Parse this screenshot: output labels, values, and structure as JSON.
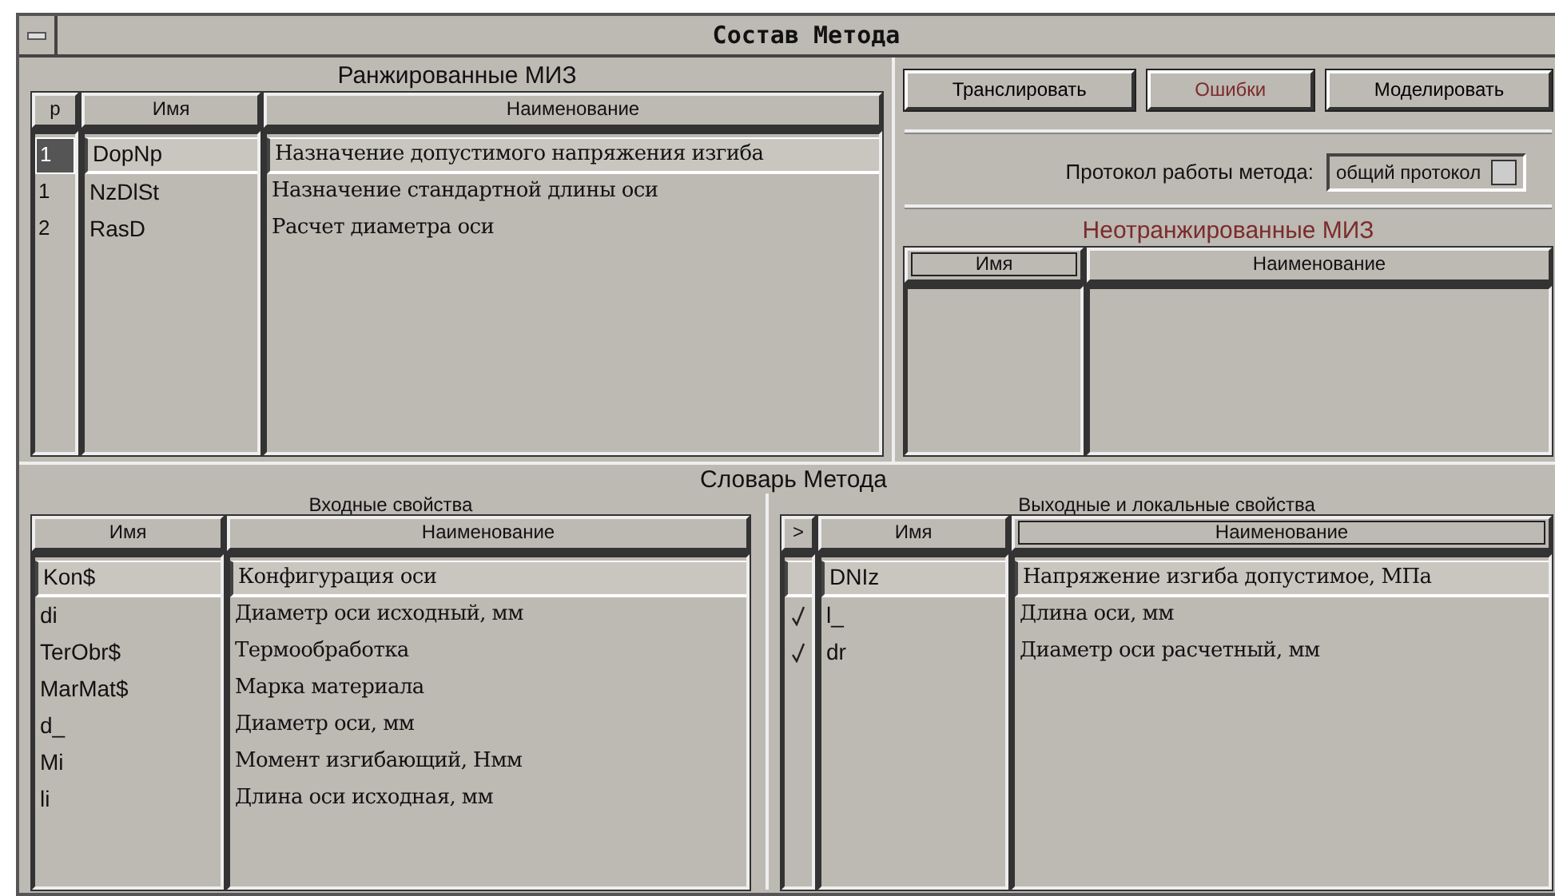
{
  "window": {
    "title": "Состав Метода"
  },
  "ranked": {
    "title": "Ранжированные МИЗ",
    "columns": [
      {
        "label": "р",
        "kind": "rank",
        "focused": false
      },
      {
        "label": "Имя",
        "kind": "name",
        "focused": false
      },
      {
        "label": "Наименование",
        "kind": "description",
        "focused": false
      }
    ],
    "rows": [
      {
        "cells": [
          "1",
          "DopNp",
          "Назначение допустимого напряжения изгиба"
        ],
        "selected": true
      },
      {
        "cells": [
          "1",
          "NzDlSt",
          "Назначение стандартной длины оси"
        ],
        "selected": false
      },
      {
        "cells": [
          "2",
          "RasD",
          "Расчет диаметра оси"
        ],
        "selected": false
      }
    ]
  },
  "actions": [
    {
      "label": "Транслировать",
      "color": "#000000"
    },
    {
      "label": "Ошибки",
      "color": "#7b2b2b"
    },
    {
      "label": "Моделировать",
      "color": "#000000"
    }
  ],
  "protocol": {
    "label": "Протокол работы метода:",
    "value": "общий протокол"
  },
  "unranked": {
    "title": "Неотранжированные МИЗ",
    "columns": [
      {
        "label": "Имя",
        "focused": true
      },
      {
        "label": "Наименование",
        "focused": false
      }
    ]
  },
  "dictionary": {
    "title": "Словарь Метода",
    "inputs": {
      "title": "Входные свойства",
      "columns": [
        {
          "label": "Имя",
          "kind": "name",
          "focused": false
        },
        {
          "label": "Наименование",
          "kind": "description",
          "focused": false
        }
      ],
      "rows": [
        {
          "cells": [
            "Kon$",
            "Конфигурация оси"
          ],
          "selected": true
        },
        {
          "cells": [
            "di",
            "Диаметр оси исходный, мм"
          ],
          "selected": false
        },
        {
          "cells": [
            "TerObr$",
            "Термообработка"
          ],
          "selected": false
        },
        {
          "cells": [
            "MarMat$",
            "Марка материала"
          ],
          "selected": false
        },
        {
          "cells": [
            "d_",
            "Диаметр оси, мм"
          ],
          "selected": false
        },
        {
          "cells": [
            "Mi",
            "Момент изгибающий, Нмм"
          ],
          "selected": false
        },
        {
          "cells": [
            "li",
            "Длина оси исходная, мм"
          ],
          "selected": false
        }
      ]
    },
    "outputs": {
      "title": "Выходные и локальные свойства",
      "columns": [
        {
          "label": ">",
          "kind": "check",
          "focused": false
        },
        {
          "label": "Имя",
          "kind": "name",
          "focused": false
        },
        {
          "label": "Наименование",
          "kind": "description",
          "focused": true
        }
      ],
      "rows": [
        {
          "cells": [
            "DNIz",
            "Напряжение изгиба допустимое, МПа"
          ],
          "checked": false,
          "selected": true
        },
        {
          "cells": [
            "l_",
            "Длина оси, мм"
          ],
          "checked": true,
          "selected": false
        },
        {
          "cells": [
            "dr",
            "Диаметр оси расчетный, мм"
          ],
          "checked": true,
          "selected": false
        }
      ]
    }
  }
}
